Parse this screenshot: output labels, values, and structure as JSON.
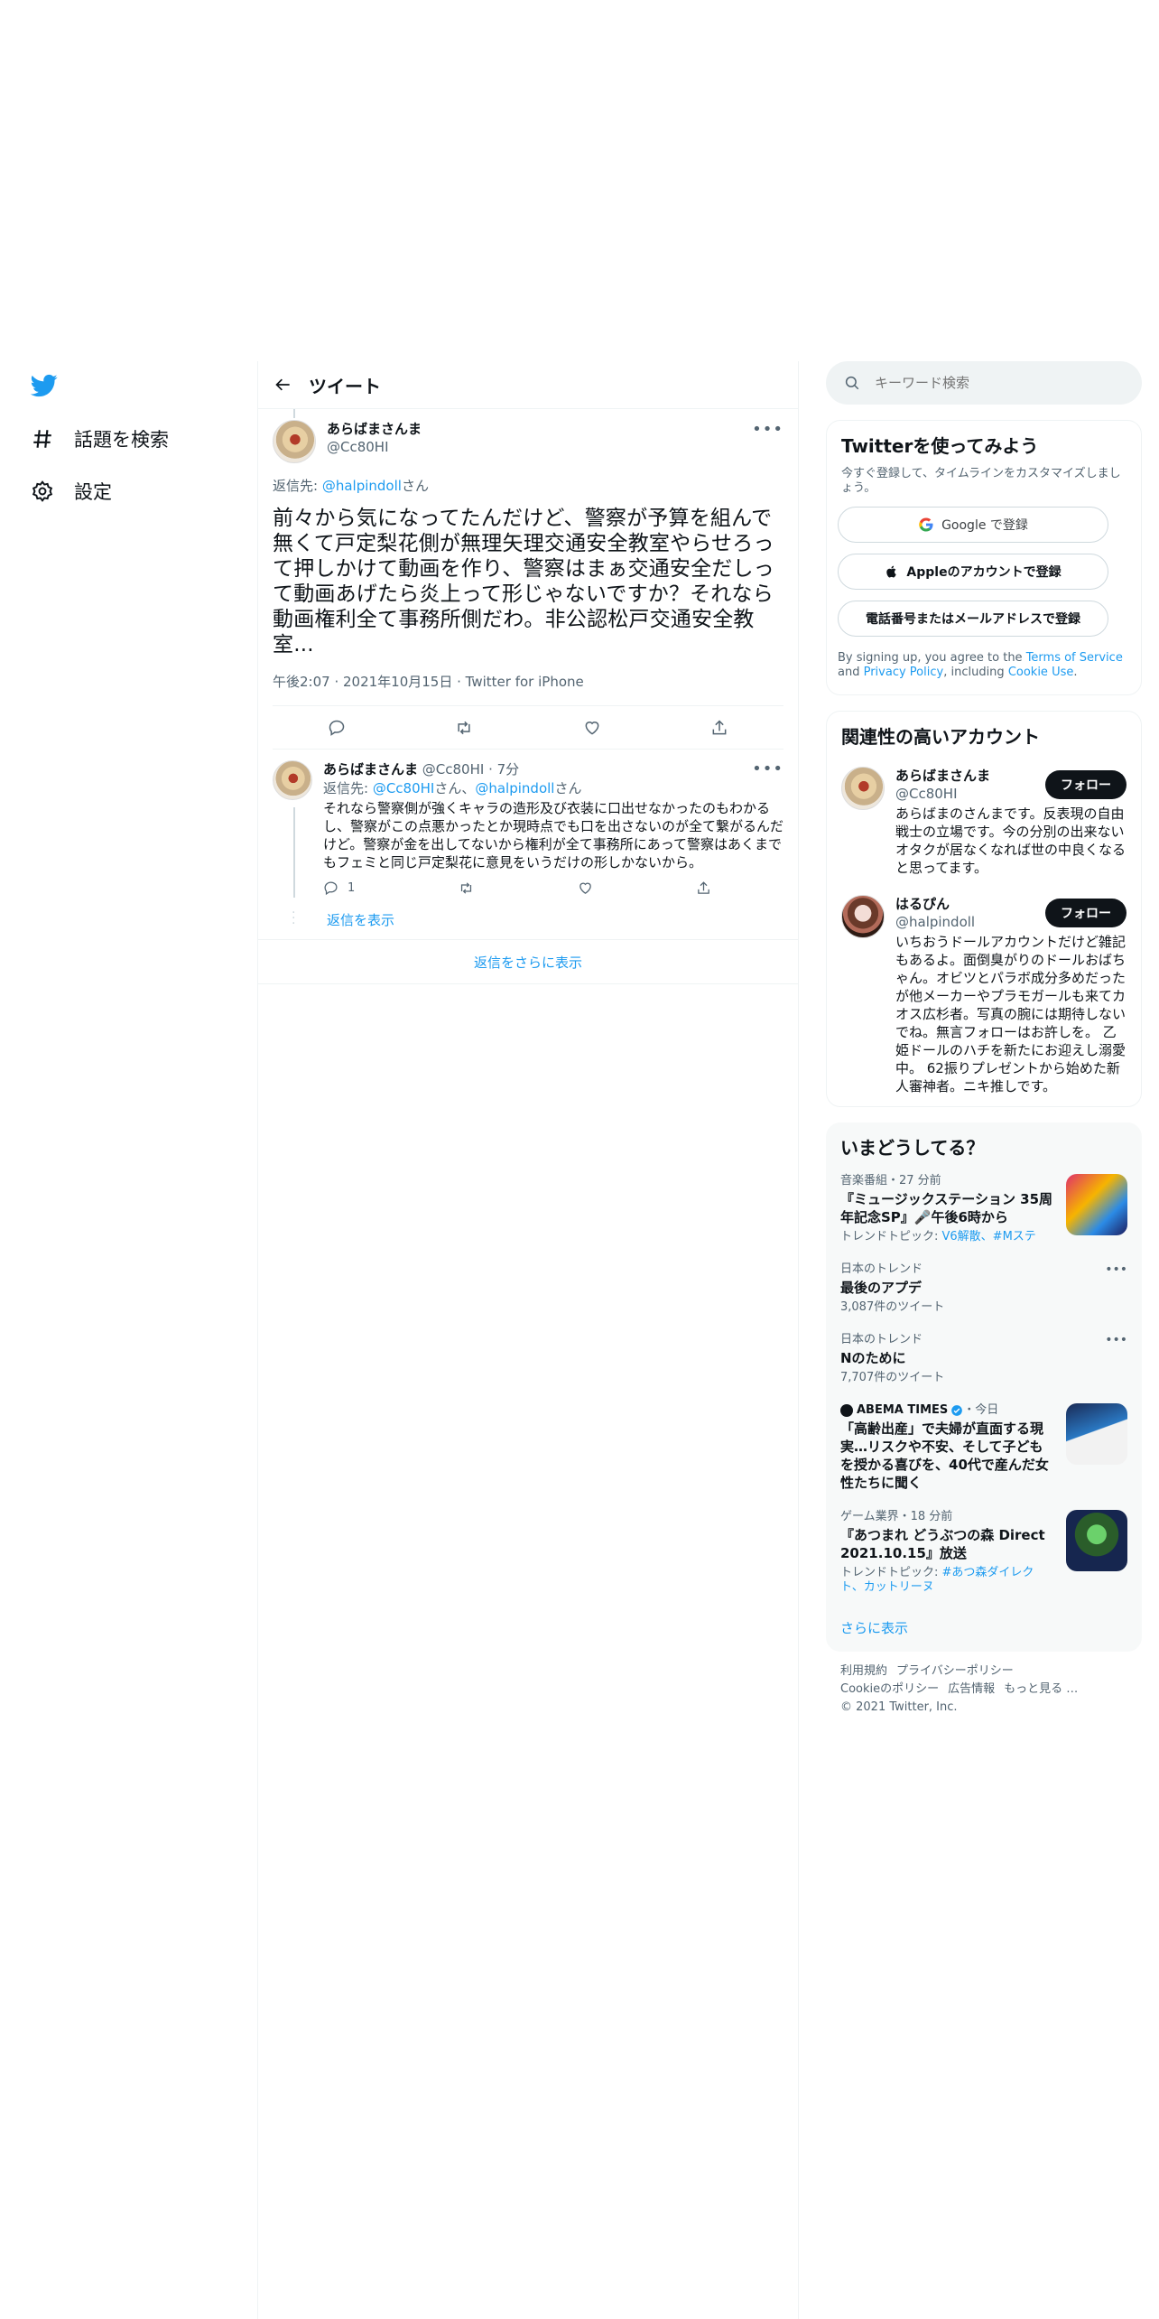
{
  "left_nav": {
    "explore_label": "話題を検索",
    "settings_label": "設定"
  },
  "header": {
    "title": "ツイート"
  },
  "main_tweet": {
    "name": "あらばまさんま",
    "handle": "@Cc80HI",
    "reply_prefix": "返信先: ",
    "reply_handle": "@halpindoll",
    "reply_suffix": "さん",
    "text": "前々から気になってたんだけど、警察が予算を組んで無くて戸定梨花側が無理矢理交通安全教室やらせろって押しかけて動画を作り、警察はまぁ交通安全だしって動画あげたら炎上って形じゃないですか？それなら動画権利全て事務所側だわ。非公認松戸交通安全教室...",
    "time": "午後2:07",
    "date": "2021年10月15日",
    "source": "Twitter for iPhone"
  },
  "reply_tweet": {
    "name": "あらばまさんま",
    "handle": "@Cc80HI",
    "age": "7分",
    "reply_prefix": "返信先: ",
    "reply_handle_1": "@Cc80HI",
    "reply_mid": "さん、",
    "reply_handle_2": "@halpindoll",
    "reply_suffix": "さん",
    "text": "それなら警察側が強くキャラの造形及び衣装に口出せなかったのもわかるし、警察がこの点悪かったとか現時点でも口を出さないのが全て繋がるんだけど。警察が金を出してないから権利が全て事務所にあって警察はあくまでもフェミと同じ戸定梨花に意見をいうだけの形しかないから。",
    "reply_count": "1",
    "show_replies": "返信を表示"
  },
  "show_more_replies": "返信をさらに表示",
  "search": {
    "placeholder": "キーワード検索"
  },
  "signup": {
    "title": "Twitterを使ってみよう",
    "subtitle": "今すぐ登録して、タイムラインをカスタマイズしましょう。",
    "google": "Google で登録",
    "apple": "Appleのアカウントで登録",
    "phone": "電話番号またはメールアドレスで登録",
    "terms_1": "By signing up, you agree to the ",
    "terms_link_1": "Terms of Service",
    "terms_2": " and ",
    "terms_link_2": "Privacy Policy",
    "terms_3": ", including ",
    "terms_link_3": "Cookie Use",
    "terms_4": "."
  },
  "relevant": {
    "title": "関連性の高いアカウント",
    "follow_label": "フォロー",
    "accounts": [
      {
        "name": "あらばまさんま",
        "handle": "@Cc80HI",
        "bio": "あらばまのさんまです。反表現の自由戦士の立場です。今の分別の出来ないオタクが居なくなれば世の中良くなると思ってます。"
      },
      {
        "name": "はるぴん",
        "handle": "@halpindoll",
        "bio": "いちおうドールアカウントだけど雑記もあるよ。面倒臭がりのドールおばちゃん。オビツとパラボ成分多めだったが他メーカーやプラモガールも来てカオス広杉者。写真の腕には期待しないでね。無言フォローはお許しを。 乙姫ドールのハチを新たにお迎えし溺愛中。 62振りプレゼントから始めた新人審神者。ニキ推しです。"
      }
    ]
  },
  "trends": {
    "title": "いまどうしてる？",
    "items": [
      {
        "context": "音楽番組・27 分前",
        "title": "『ミュージックステーション 35周年記念SP』🎤午後6時から",
        "sub_prefix": "トレンドトピック: ",
        "sub_links": "V6解散、#Mステ"
      },
      {
        "context": "日本のトレンド",
        "title": "最後のアプデ",
        "sub": "3,087件のツイート"
      },
      {
        "context": "日本のトレンド",
        "title": "Nのために",
        "sub": "7,707件のツイート"
      },
      {
        "context_name": "ABEMA TIMES",
        "context_time": "・今日",
        "title": "「高齢出産」で夫婦が直面する現実…リスクや不安、そして子どもを授かる喜びを、40代で産んだ女性たちに聞く"
      },
      {
        "context": "ゲーム業界・18 分前",
        "title": "『あつまれ どうぶつの森 Direct 2021.10.15』放送",
        "sub_prefix": "トレンドトピック: ",
        "sub_links": "#あつ森ダイレクト、カットリーヌ"
      }
    ],
    "show_more": "さらに表示"
  },
  "footer": {
    "terms": "利用規約",
    "privacy": "プライバシーポリシー",
    "cookie": "Cookieのポリシー",
    "ads": "広告情報",
    "more": "もっと見る …",
    "copyright": "© 2021 Twitter, Inc."
  },
  "colors": {
    "accent": "#1d9bf0",
    "text": "#0f1419",
    "secondary": "#536471"
  }
}
